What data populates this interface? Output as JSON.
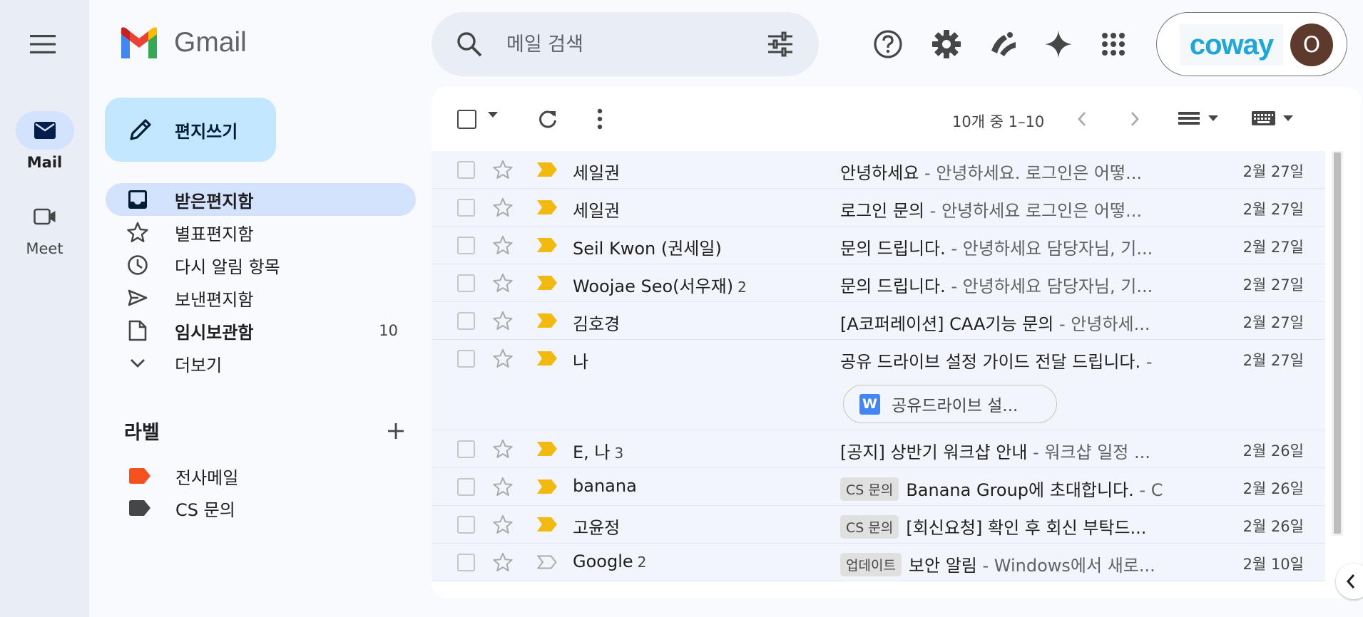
{
  "rail": {
    "items": [
      {
        "label": "Mail",
        "icon": "mail-icon",
        "active": true
      },
      {
        "label": "Meet",
        "icon": "video-icon",
        "active": false
      }
    ]
  },
  "header": {
    "app_name": "Gmail",
    "search_placeholder": "메일 검색",
    "brand_text": "coway",
    "avatar_letter": "O",
    "icons": [
      "help-icon",
      "settings-icon",
      "gemini-like-icon",
      "sparkle-icon",
      "apps-grid-icon"
    ]
  },
  "sidebar": {
    "compose_label": "편지쓰기",
    "nav": [
      {
        "label": "받은편지함",
        "icon": "inbox-icon",
        "active": true,
        "bold": true,
        "count": ""
      },
      {
        "label": "별표편지함",
        "icon": "star-icon",
        "active": false,
        "bold": false,
        "count": ""
      },
      {
        "label": "다시 알림 항목",
        "icon": "clock-icon",
        "active": false,
        "bold": false,
        "count": ""
      },
      {
        "label": "보낸편지함",
        "icon": "send-icon",
        "active": false,
        "bold": false,
        "count": ""
      },
      {
        "label": "임시보관함",
        "icon": "draft-icon",
        "active": false,
        "bold": true,
        "count": "10"
      },
      {
        "label": "더보기",
        "icon": "chevron-down-icon",
        "active": false,
        "bold": false,
        "count": ""
      }
    ],
    "labels_title": "라벨",
    "labels": [
      {
        "name": "전사메일",
        "color": "#f4511e"
      },
      {
        "name": "CS 문의",
        "color": "#444746"
      }
    ]
  },
  "toolbar": {
    "range_text": "10개 중 1–10"
  },
  "emails": [
    {
      "sender": "세일권",
      "count": "",
      "chip": "",
      "subject": "안녕하세요",
      "snippet": " - 안녕하세요. 로그인은 어떻...",
      "date": "2월 27일",
      "important": true,
      "attachment": ""
    },
    {
      "sender": "세일권",
      "count": "",
      "chip": "",
      "subject": "로그인 문의",
      "snippet": " - 안녕하세요 로그인은 어떻...",
      "date": "2월 27일",
      "important": true,
      "attachment": ""
    },
    {
      "sender": "Seil Kwon (권세일)",
      "count": "",
      "chip": "",
      "subject": "문의 드립니다.",
      "snippet": " - 안녕하세요 담당자님, 기...",
      "date": "2월 27일",
      "important": true,
      "attachment": ""
    },
    {
      "sender": "Woojae Seo(서우재)",
      "count": "2",
      "chip": "",
      "subject": "문의 드립니다.",
      "snippet": " - 안녕하세요 담당자님, 기...",
      "date": "2월 27일",
      "important": true,
      "attachment": ""
    },
    {
      "sender": "김호경",
      "count": "",
      "chip": "",
      "subject": "[A코퍼레이션] CAA기능 문의",
      "snippet": " - 안녕하세...",
      "date": "2월 27일",
      "important": true,
      "attachment": ""
    },
    {
      "sender": "나",
      "count": "",
      "chip": "",
      "subject": "공유 드라이브 설정 가이드 전달 드립니다.",
      "snippet": " -",
      "date": "2월 27일",
      "important": true,
      "attachment": "공유드라이브 설..."
    },
    {
      "sender": "E, 나",
      "count": "3",
      "chip": "",
      "subject": "[공지] 상반기 워크샵 안내",
      "snippet": " - 워크샵 일정 ...",
      "date": "2월 26일",
      "important": true,
      "attachment": ""
    },
    {
      "sender": "banana",
      "count": "",
      "chip": "CS 문의",
      "subject": "Banana Group에 초대합니다.",
      "snippet": " - C",
      "date": "2월 26일",
      "important": true,
      "attachment": ""
    },
    {
      "sender": "고윤정",
      "count": "",
      "chip": "CS 문의",
      "subject": "[회신요청] 확인 후 회신 부탁드...",
      "snippet": "",
      "date": "2월 26일",
      "important": true,
      "attachment": ""
    },
    {
      "sender": "Google",
      "count": "2",
      "chip": "업데이트",
      "subject": "보안 알림",
      "snippet": " - Windows에서 새로...",
      "date": "2월 10일",
      "important": false,
      "attachment": ""
    }
  ]
}
